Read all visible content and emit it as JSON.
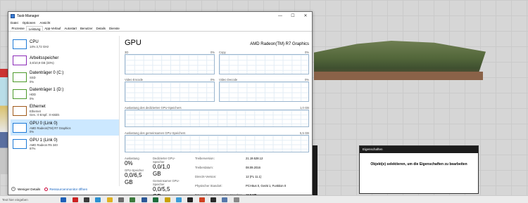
{
  "window": {
    "title": "Task-Manager",
    "controls": {
      "minimize": "—",
      "maximize": "☐",
      "close": "✕"
    }
  },
  "menu": [
    "Datei",
    "Optionen",
    "Ansicht"
  ],
  "tabs": [
    "Prozesse",
    "Leistung",
    "App-Verlauf",
    "Autostart",
    "Benutzer",
    "Details",
    "Dienste"
  ],
  "active_tab": "Leistung",
  "sidebar": [
    {
      "name": "CPU",
      "sub1": "14% 3,72 GHz",
      "sub2": "",
      "color": "#1e7ad6"
    },
    {
      "name": "Arbeitsspeicher",
      "sub1": "3,6/10,9 GB (33%)",
      "sub2": "",
      "color": "#8b2bb8"
    },
    {
      "name": "Datenträger 0 (C:)",
      "sub1": "SSD",
      "sub2": "0%",
      "color": "#4c9a2a"
    },
    {
      "name": "Datenträger 1 (D:)",
      "sub1": "HDD",
      "sub2": "0%",
      "color": "#4c9a2a"
    },
    {
      "name": "Ethernet",
      "sub1": "Ethernet",
      "sub2": "Ges.: 0 Empf.: 0 KBit/s",
      "color": "#a05a1a"
    },
    {
      "name": "GPU 0 (Link 0)",
      "sub1": "AMD Radeon(TM) R7 Graphics",
      "sub2": "0%",
      "color": "#1e7ad6"
    },
    {
      "name": "GPU 1 (Link 0)",
      "sub1": "AMD Radeon R5 340",
      "sub2": "87%",
      "color": "#1e7ad6"
    }
  ],
  "gpu": {
    "title": "GPU",
    "model": "AMD Radeon(TM) R7 Graphics",
    "engines": [
      {
        "name": "3D",
        "pct": "0%"
      },
      {
        "name": "Copy",
        "pct": "0%"
      },
      {
        "name": "Video Encode",
        "pct": "0%"
      },
      {
        "name": "Video Decode",
        "pct": "0%"
      }
    ],
    "dedicated": {
      "label": "Auslastung des dedizierten GPU-Speichers",
      "max": "1,0 GB"
    },
    "shared": {
      "label": "Auslastung des gemeinsamen GPU-Speichers",
      "max": "5,5 GB"
    }
  },
  "stats": {
    "auslastung_label": "Auslastung",
    "auslastung_value": "0%",
    "ded_label": "Dedizierter GPU-Speicher",
    "ded_value": "0,0/1,0 GB",
    "gpu_mem_label": "GPU-Speicher",
    "gpu_mem_value": "0,0/6,5 GB",
    "shared_label": "Gemeinsamer GPU-Speicher",
    "shared_value": "0,0/5,5 GB"
  },
  "info": [
    {
      "k": "Treiberversion:",
      "v": "21.19.528.12"
    },
    {
      "k": "Treiberdatum:",
      "v": "08.09.2016"
    },
    {
      "k": "DirectX-Version:",
      "v": "12 (FL 11.1)"
    },
    {
      "k": "Physischer Standort:",
      "v": "PCI-Bus 0, Gerät 1, Funktion 0"
    },
    {
      "k": "Für Hardware reservierter Speicher:",
      "v": "18,9 MB"
    }
  ],
  "footer": {
    "fewer": "Weniger Details",
    "monitor": "Ressourcenmonitor öffnen"
  },
  "properties": {
    "header": "Eigenschaften",
    "message": "Objekt(e) selektieren, um die Eigenschaften zu bearbeiten"
  },
  "taskbar": {
    "search": "Text hier eingeben",
    "icons": [
      "#1d5fb8",
      "#c22",
      "#3a3a3a",
      "#2a8fd0",
      "#e0b020",
      "#6b6b6b",
      "#3c7a3c",
      "#2b5797",
      "#1d6b3a",
      "#c8a000",
      "#3b9bd6",
      "#222",
      "#d04020",
      "#2a2a2a",
      "#5577aa",
      "#888"
    ]
  }
}
